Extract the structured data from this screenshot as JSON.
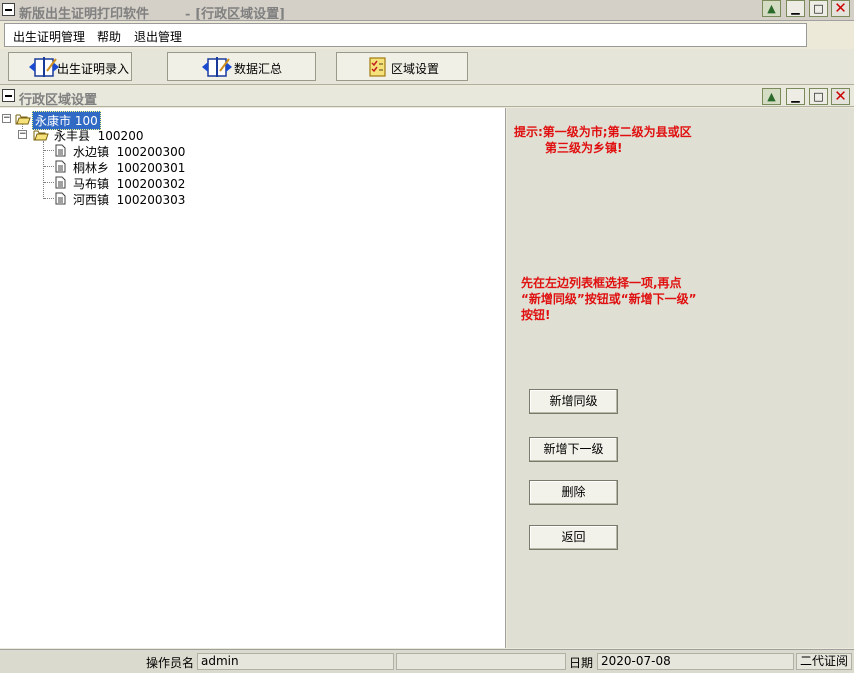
{
  "app": {
    "title": "新版出生证明打印软件",
    "subtitle": "- [行政区域设置]"
  },
  "menu": [
    "出生证明管理",
    "帮助",
    "退出管理"
  ],
  "toolbar": {
    "buttons": [
      {
        "label": "出生证明录入",
        "icon": "notebook-icon"
      },
      {
        "label": "数据汇总",
        "icon": "notebook-icon"
      },
      {
        "label": "区域设置",
        "icon": "checklist-icon"
      }
    ]
  },
  "child_window": {
    "title": "行政区域设置"
  },
  "tree": {
    "root": {
      "name": "永康市",
      "code": "100",
      "selected": true
    },
    "county": {
      "name": "永丰县",
      "code": "100200"
    },
    "towns": [
      {
        "name": "水边镇",
        "code": "100200300"
      },
      {
        "name": "桐林乡",
        "code": "100200301"
      },
      {
        "name": "马布镇",
        "code": "100200302"
      },
      {
        "name": "河西镇",
        "code": "100200303"
      }
    ]
  },
  "hints": {
    "line1a": "提示:第一级为市;第二级为县或区",
    "line1b": "第三级为乡镇!",
    "line2a": "先在左边列表框选择一项,再点",
    "line2b": "“新增同级”按钮或“新增下一级”",
    "line2c": "按钮!"
  },
  "actions": {
    "add_sibling": "新增同级",
    "add_child": "新增下一级",
    "delete": "删除",
    "back": "返回"
  },
  "status": {
    "operator_label": "操作员名",
    "operator_value": "admin",
    "date_label": "日期",
    "date_value": "2020-07-08",
    "mode": "二代证阅"
  },
  "colors": {
    "hint_red": "#E01010",
    "selection_blue": "#316AC5"
  }
}
